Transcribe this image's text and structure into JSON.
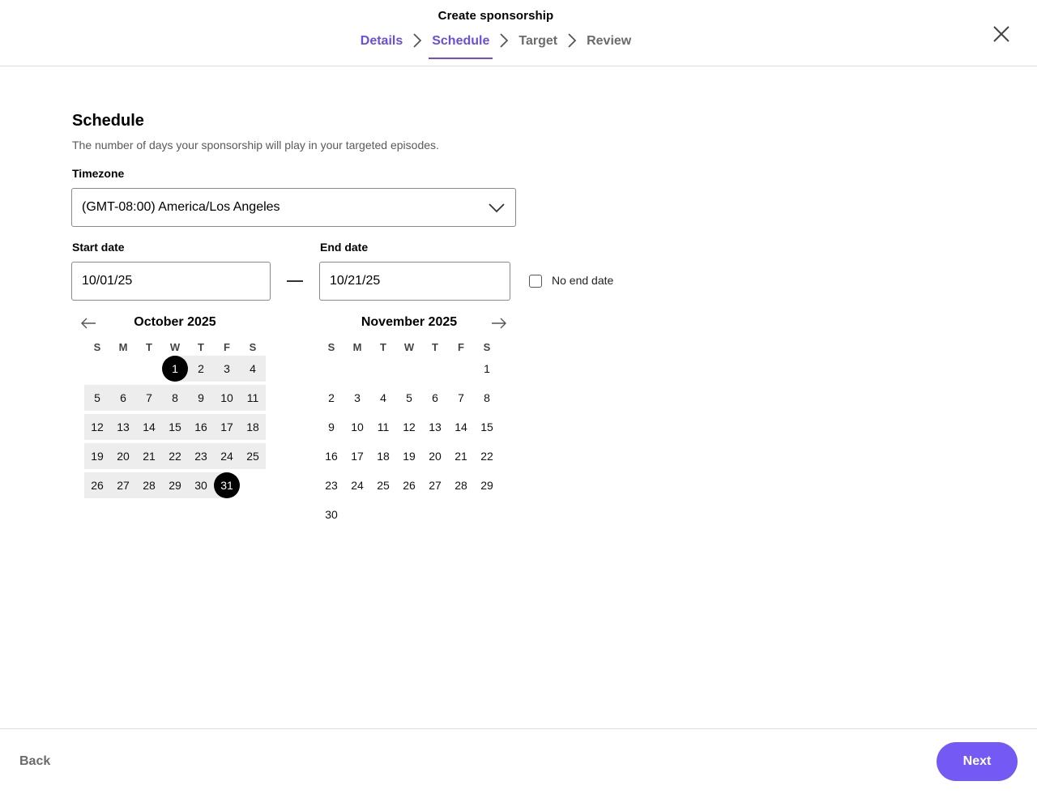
{
  "modal": {
    "title": "Create sponsorship",
    "steps": [
      {
        "label": "Details",
        "state": "done"
      },
      {
        "label": "Schedule",
        "state": "active"
      },
      {
        "label": "Target",
        "state": "pending"
      },
      {
        "label": "Review",
        "state": "pending"
      }
    ],
    "close_icon": "close-icon"
  },
  "schedule": {
    "title": "Schedule",
    "description": "The number of days your sponsorship will play in your targeted episodes.",
    "timezone_label": "Timezone",
    "timezone_value": "(GMT-08:00) America/Los Angeles",
    "start_label": "Start date",
    "start_value": "10/01/25",
    "end_label": "End date",
    "end_value": "10/21/25",
    "no_end_label": "No end date",
    "no_end_checked": false
  },
  "calendar": {
    "weekdays": [
      "S",
      "M",
      "T",
      "W",
      "T",
      "F",
      "S"
    ],
    "months": [
      {
        "title": "October 2025",
        "first_weekday": 3,
        "days": 31,
        "range_start": 1,
        "range_end": 31,
        "selected": [
          1,
          31
        ]
      },
      {
        "title": "November 2025",
        "first_weekday": 6,
        "days": 30,
        "range_start": null,
        "range_end": null,
        "selected": []
      }
    ]
  },
  "footer": {
    "back_label": "Back",
    "next_label": "Next"
  },
  "colors": {
    "accent": "#7559f4",
    "step_active": "#6a4ee0",
    "range_fill": "#ededed",
    "selected": "#000000"
  }
}
